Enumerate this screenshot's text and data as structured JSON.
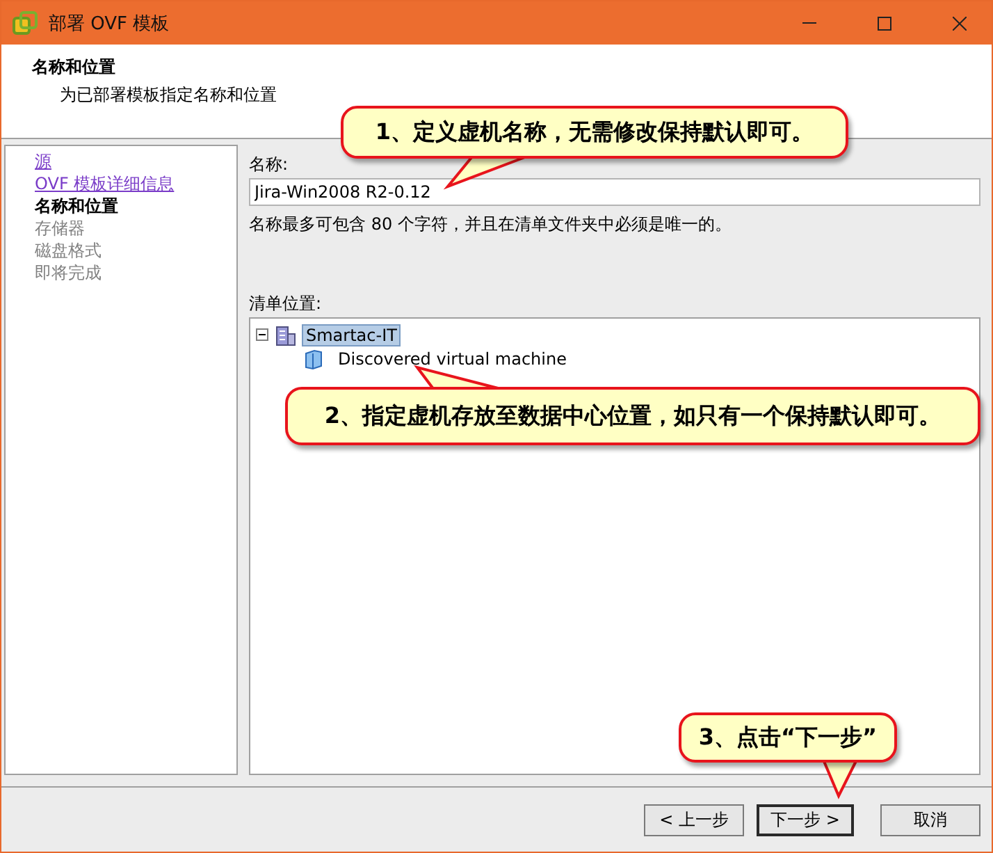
{
  "window": {
    "title": "部署 OVF 模板"
  },
  "header": {
    "title": "名称和位置",
    "subtitle": "为已部署模板指定名称和位置"
  },
  "steps": [
    {
      "label": "源",
      "kind": "link"
    },
    {
      "label": "OVF 模板详细信息",
      "kind": "link"
    },
    {
      "label": "名称和位置",
      "kind": "current"
    },
    {
      "label": "存储器",
      "kind": "pending"
    },
    {
      "label": "磁盘格式",
      "kind": "pending"
    },
    {
      "label": "即将完成",
      "kind": "pending"
    }
  ],
  "name_field": {
    "label": "名称:",
    "value": "Jira-Win2008 R2-0.12",
    "hint": "名称最多可包含 80 个字符，并且在清单文件夹中必须是唯一的。"
  },
  "inventory": {
    "label": "清单位置:",
    "tree": [
      {
        "label": "Smartac-IT",
        "kind": "datacenter",
        "expanded": true,
        "selected": true,
        "children": [
          {
            "label": "Discovered virtual machine",
            "kind": "folder",
            "selected": false
          }
        ]
      }
    ]
  },
  "buttons": [
    {
      "label": "< 上一步",
      "default": false
    },
    {
      "label": "下一步 >",
      "default": true
    },
    {
      "label": "取消",
      "default": false
    }
  ],
  "callouts": [
    {
      "text": "1、定义虚机名称，无需修改保持默认即可。"
    },
    {
      "text": "2、指定虚机存放至数据中心位置，如只有一个保持默认即可。"
    },
    {
      "text": "3、点击“下一步”"
    }
  ]
}
